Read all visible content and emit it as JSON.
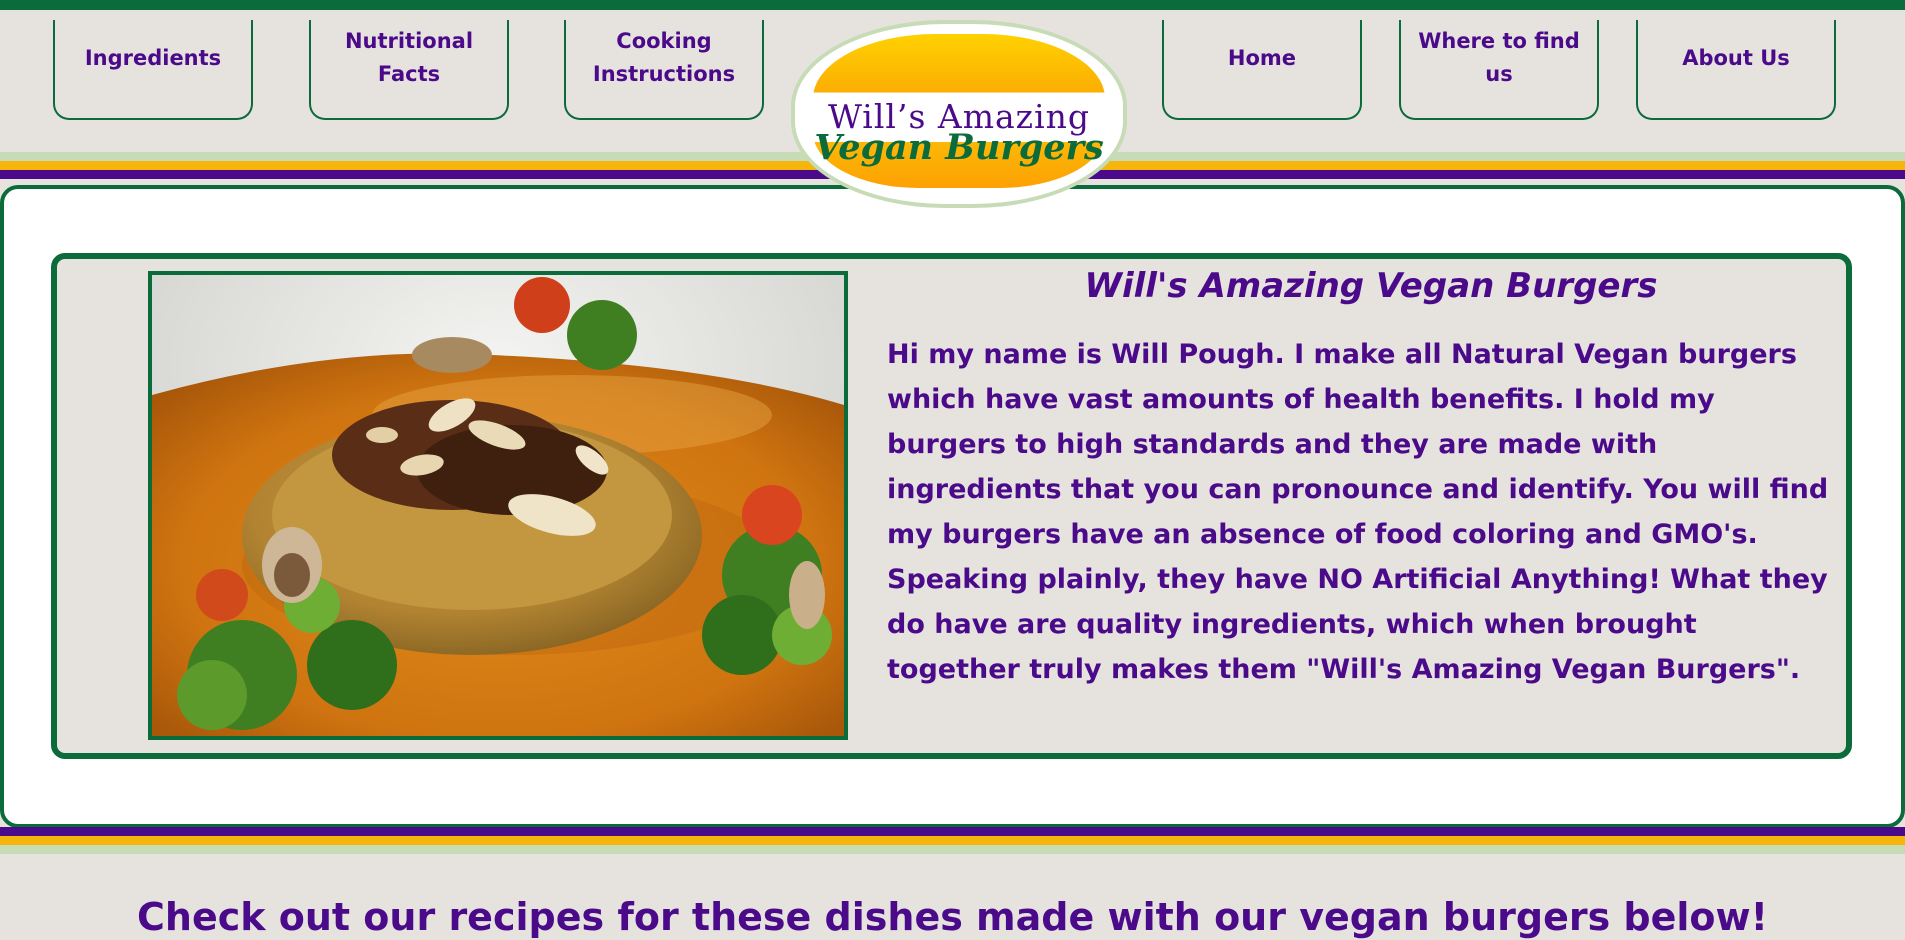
{
  "nav": {
    "left": [
      {
        "label": "Ingredients"
      },
      {
        "label": "Nutritional Facts"
      },
      {
        "label": "Cooking Instructions"
      }
    ],
    "right": [
      {
        "label": "Home"
      },
      {
        "label": "Where to find us"
      },
      {
        "label": "About Us"
      }
    ]
  },
  "logo": {
    "line1": "Will’s Amazing",
    "line2": "Vegan Burgers"
  },
  "feature": {
    "title": "Will's Amazing Vegan Burgers",
    "body": "Hi my name is Will Pough. I make all Natural Vegan burgers which have vast amounts of health benefits. I hold my burgers to high standards and they are made with ingredients that you can pronounce and identify. You will find my burgers have an absence of food coloring and GMO's. Speaking plainly, they have NO Artificial Anything! What they do have are quality ingredients, which when brought together truly makes them \"Will's Amazing Vegan Burgers\"."
  },
  "recipes_heading": "Check out our recipes for these dishes made with our vegan burgers below!",
  "colors": {
    "brand_green": "#0b6b3a",
    "brand_purple": "#4a0a8a",
    "accent_yellow": "#f5b50a",
    "light_green": "#c6dbb6",
    "background": "#e6e3de"
  }
}
